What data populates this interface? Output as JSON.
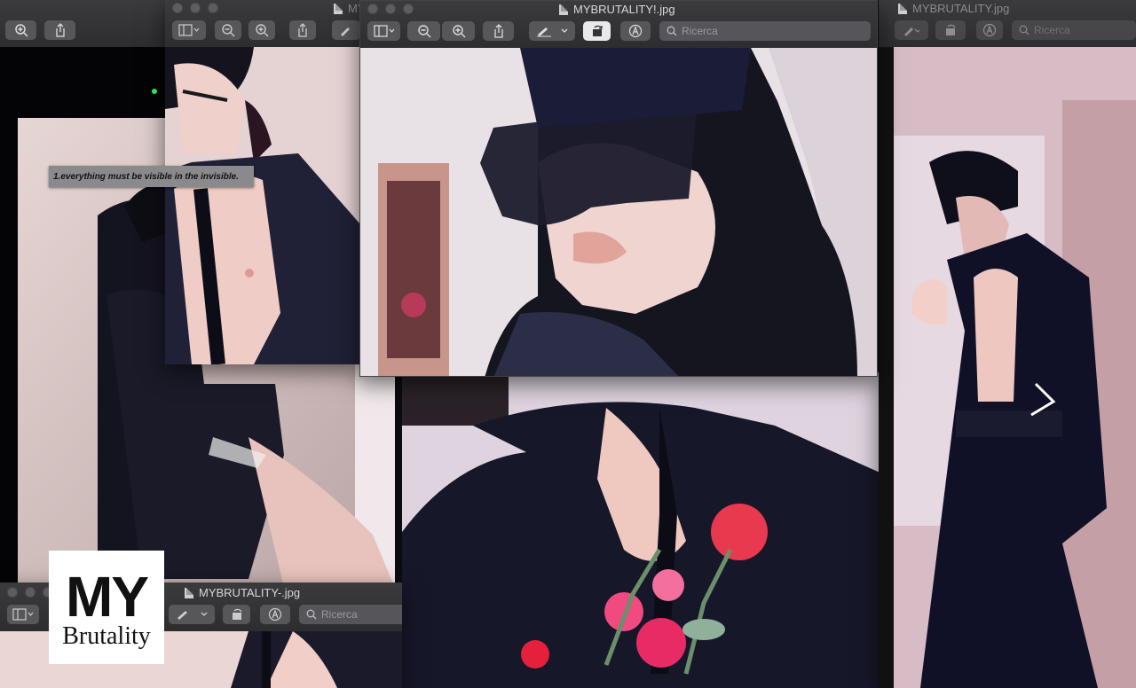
{
  "windows": {
    "left_back": {
      "title": "MY"
    },
    "right_back": {
      "title": "MYBRUTALITY.jpg",
      "search_placeholder": "Ricerca"
    },
    "front": {
      "title": "MYBRUTALITY!.jpg",
      "search_placeholder": "Ricerca"
    },
    "bottom_left": {
      "title": "MYBRUTALITY-.jpg",
      "search_placeholder": "Ricerca"
    }
  },
  "caption": "1.everything must be visible in the invisible.",
  "logo": {
    "line1": "MY",
    "line2": "Brutality"
  },
  "colors": {
    "toolbar": "#333335",
    "button": "#575759",
    "highlight": "#e9e9ea"
  },
  "icons": [
    "zoom-out-icon",
    "zoom-in-icon",
    "share-icon",
    "markup-icon",
    "rotate-icon",
    "annotate-icon",
    "search-icon",
    "sidebar-icon"
  ]
}
